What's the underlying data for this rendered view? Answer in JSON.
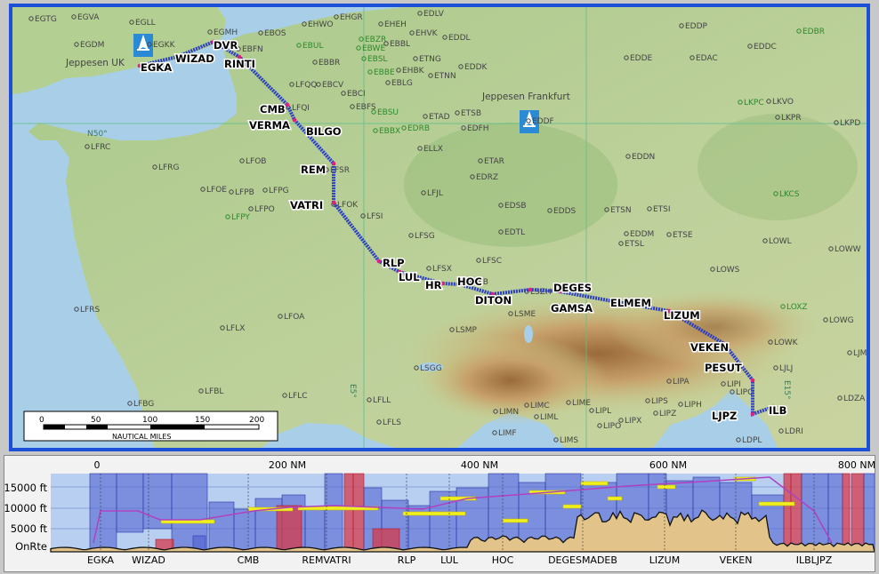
{
  "map": {
    "labels": {
      "jeppesen_uk": "Jeppesen UK",
      "jeppesen_frankfurt": "Jeppesen Frankfurt",
      "lat_n50": "N50°",
      "lon_e5": "E5°",
      "lon_e15": "E15°"
    },
    "scale": {
      "ticks": [
        "0",
        "50",
        "100",
        "150",
        "200"
      ],
      "units": "NAUTICAL MILES"
    },
    "airports": [
      {
        "code": "EGTG",
        "c": "#444"
      },
      {
        "code": "EGVA",
        "c": "#444"
      },
      {
        "code": "EGLL",
        "c": "#444"
      },
      {
        "code": "EGMH",
        "c": "#444"
      },
      {
        "code": "EGDM",
        "c": "#444"
      },
      {
        "code": "EGKK",
        "c": "#444"
      },
      {
        "code": "EBOS",
        "c": "#444"
      },
      {
        "code": "EBFN",
        "c": "#444"
      },
      {
        "code": "EHWO",
        "c": "#444"
      },
      {
        "code": "EHGR",
        "c": "#444"
      },
      {
        "code": "EHEH",
        "c": "#444"
      },
      {
        "code": "EDLV",
        "c": "#444"
      },
      {
        "code": "EBZR",
        "c": "#2b8a2b"
      },
      {
        "code": "EBWE",
        "c": "#2b8a2b"
      },
      {
        "code": "EBBL",
        "c": "#444"
      },
      {
        "code": "EHVK",
        "c": "#444"
      },
      {
        "code": "EDDL",
        "c": "#444"
      },
      {
        "code": "EBUL",
        "c": "#2b8a2b"
      },
      {
        "code": "EBBR",
        "c": "#444"
      },
      {
        "code": "EBSL",
        "c": "#2b8a2b"
      },
      {
        "code": "ETNG",
        "c": "#444"
      },
      {
        "code": "EBBE",
        "c": "#2b8a2b"
      },
      {
        "code": "EHBK",
        "c": "#444"
      },
      {
        "code": "ETNN",
        "c": "#444"
      },
      {
        "code": "EDDK",
        "c": "#444"
      },
      {
        "code": "EBLG",
        "c": "#444"
      },
      {
        "code": "EDDP",
        "c": "#444"
      },
      {
        "code": "EDBR",
        "c": "#2b8a2b"
      },
      {
        "code": "EDDC",
        "c": "#444"
      },
      {
        "code": "EDDE",
        "c": "#444"
      },
      {
        "code": "EDAC",
        "c": "#444"
      },
      {
        "code": "LFQQ",
        "c": "#444"
      },
      {
        "code": "EBCV",
        "c": "#444"
      },
      {
        "code": "EBCI",
        "c": "#444"
      },
      {
        "code": "EBFS",
        "c": "#444"
      },
      {
        "code": "LFQI",
        "c": "#444"
      },
      {
        "code": "EBSU",
        "c": "#2b8a2b"
      },
      {
        "code": "ETAD",
        "c": "#444"
      },
      {
        "code": "ETSB",
        "c": "#444"
      },
      {
        "code": "EBBX",
        "c": "#2b8a2b"
      },
      {
        "code": "EDRB",
        "c": "#2b8a2b"
      },
      {
        "code": "EDFH",
        "c": "#444"
      },
      {
        "code": "EDDF",
        "c": "#444"
      },
      {
        "code": "LKPC",
        "c": "#2b8a2b"
      },
      {
        "code": "LKVO",
        "c": "#444"
      },
      {
        "code": "LKPR",
        "c": "#444"
      },
      {
        "code": "LKPD",
        "c": "#444"
      },
      {
        "code": "LFRC",
        "c": "#444"
      },
      {
        "code": "ELLX",
        "c": "#444"
      },
      {
        "code": "ETAR",
        "c": "#444"
      },
      {
        "code": "EDDN",
        "c": "#444"
      },
      {
        "code": "LFRG",
        "c": "#444"
      },
      {
        "code": "LFOB",
        "c": "#444"
      },
      {
        "code": "LFSR",
        "c": "#444"
      },
      {
        "code": "EDRZ",
        "c": "#444"
      },
      {
        "code": "LFOE",
        "c": "#444"
      },
      {
        "code": "LFPB",
        "c": "#444"
      },
      {
        "code": "LFPG",
        "c": "#444"
      },
      {
        "code": "LFJL",
        "c": "#444"
      },
      {
        "code": "LKCS",
        "c": "#2b8a2b"
      },
      {
        "code": "LFPO",
        "c": "#444"
      },
      {
        "code": "LFOK",
        "c": "#444"
      },
      {
        "code": "EDSB",
        "c": "#444"
      },
      {
        "code": "EDDS",
        "c": "#444"
      },
      {
        "code": "ETSN",
        "c": "#444"
      },
      {
        "code": "ETSI",
        "c": "#444"
      },
      {
        "code": "LFPY",
        "c": "#2b8a2b"
      },
      {
        "code": "LFSI",
        "c": "#444"
      },
      {
        "code": "EDTL",
        "c": "#444"
      },
      {
        "code": "EDDM",
        "c": "#444"
      },
      {
        "code": "ETSE",
        "c": "#444"
      },
      {
        "code": "LOWL",
        "c": "#444"
      },
      {
        "code": "ETSL",
        "c": "#444"
      },
      {
        "code": "LFSG",
        "c": "#444"
      },
      {
        "code": "LOWW",
        "c": "#444"
      },
      {
        "code": "LFSC",
        "c": "#444"
      },
      {
        "code": "LOWS",
        "c": "#444"
      },
      {
        "code": "LFSX",
        "c": "#444"
      },
      {
        "code": "LFSB",
        "c": "#444"
      },
      {
        "code": "LSZH",
        "c": "#444"
      },
      {
        "code": "LOXZ",
        "c": "#2b8a2b"
      },
      {
        "code": "LFRS",
        "c": "#444"
      },
      {
        "code": "LFOA",
        "c": "#444"
      },
      {
        "code": "LSME",
        "c": "#444"
      },
      {
        "code": "LOWG",
        "c": "#444"
      },
      {
        "code": "LFLX",
        "c": "#444"
      },
      {
        "code": "LSMP",
        "c": "#444"
      },
      {
        "code": "LOWK",
        "c": "#444"
      },
      {
        "code": "LJMB",
        "c": "#444"
      },
      {
        "code": "LSGG",
        "c": "#444"
      },
      {
        "code": "LJLJ",
        "c": "#444"
      },
      {
        "code": "LIPA",
        "c": "#444"
      },
      {
        "code": "LIPI",
        "c": "#444"
      },
      {
        "code": "LFBL",
        "c": "#444"
      },
      {
        "code": "LFLC",
        "c": "#444"
      },
      {
        "code": "LIPQ",
        "c": "#444"
      },
      {
        "code": "LDZA",
        "c": "#444"
      },
      {
        "code": "LFBG",
        "c": "#444"
      },
      {
        "code": "LFLL",
        "c": "#444"
      },
      {
        "code": "LIMC",
        "c": "#444"
      },
      {
        "code": "LIME",
        "c": "#444"
      },
      {
        "code": "LIPS",
        "c": "#444"
      },
      {
        "code": "LIPH",
        "c": "#444"
      },
      {
        "code": "LIMN",
        "c": "#444"
      },
      {
        "code": "LIML",
        "c": "#444"
      },
      {
        "code": "LIPL",
        "c": "#444"
      },
      {
        "code": "LIPZ",
        "c": "#444"
      },
      {
        "code": "LFLS",
        "c": "#444"
      },
      {
        "code": "LIPO",
        "c": "#444"
      },
      {
        "code": "LIPX",
        "c": "#444"
      },
      {
        "code": "LDRI",
        "c": "#444"
      },
      {
        "code": "LIMF",
        "c": "#444"
      },
      {
        "code": "LIMS",
        "c": "#444"
      },
      {
        "code": "LDPL",
        "c": "#444"
      }
    ],
    "waypoints": [
      "EGKA",
      "WIZAD",
      "DVR",
      "RINTI",
      "CMB",
      "VERMA",
      "BILGO",
      "REM",
      "VATRI",
      "RLP",
      "LUL",
      "HR",
      "HOC",
      "DITON",
      "GAMSA",
      "DEGES",
      "ELMEM",
      "LIZUM",
      "VEKEN",
      "PESUT",
      "ILB",
      "LJPZ"
    ]
  },
  "profile": {
    "nm_ticks": [
      "0",
      "200 NM",
      "400 NM",
      "600 NM",
      "800 NM"
    ],
    "alt_labels": [
      "15000 ft",
      "10000 ft",
      "5000 ft",
      "OnRte"
    ],
    "waypoints": [
      "EGKA",
      "WIZAD",
      "CMB",
      "REMVATRI",
      "RLP",
      "LUL",
      "HOC",
      "DEGESMADEB",
      "LIZUM",
      "VEKEN",
      "ILBLJPZ"
    ]
  },
  "colors": {
    "frame_blue": "#1c4fd6",
    "sea": "#a9cfe8",
    "route": "#2a3fc4",
    "profile_bg": "#b8cff2",
    "block_blue": "#4a5bd0",
    "block_red": "#d63a4a",
    "alt_bar": "#f0f020",
    "terrain": "#e2c48a"
  }
}
